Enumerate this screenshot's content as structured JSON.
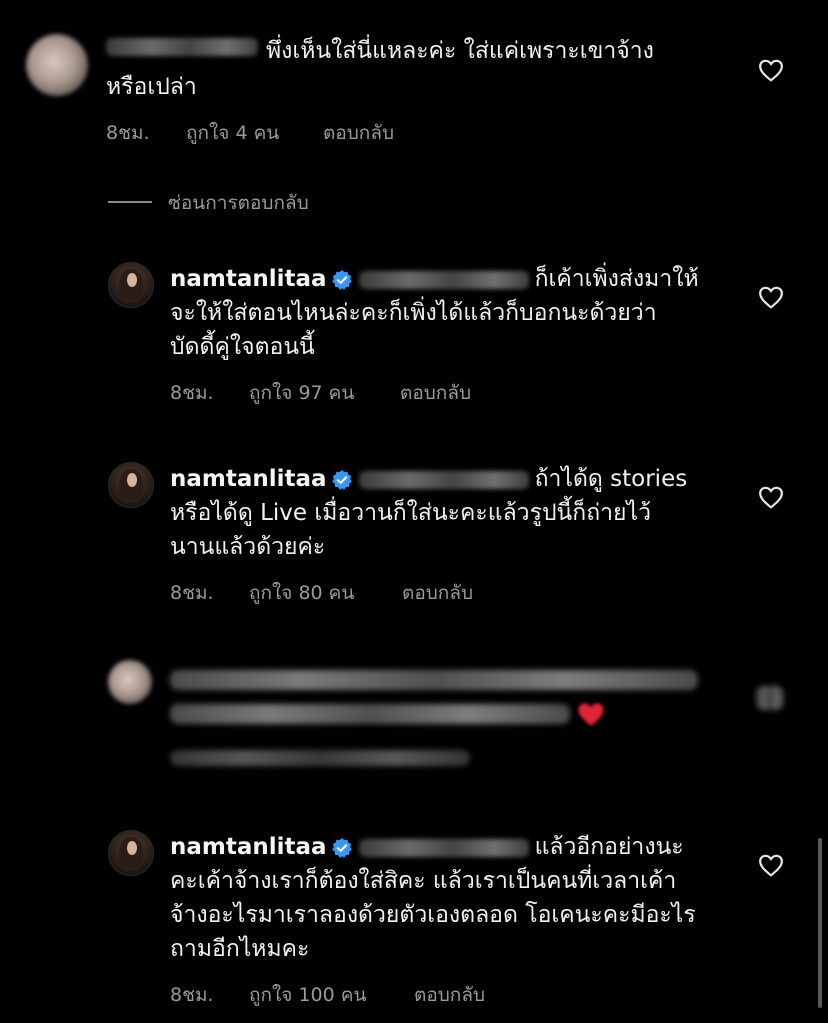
{
  "comment1": {
    "text_line1": "พึ่งเห็นใส่นี่แหละค่ะ ใส่แค่เพราะเขาจ้าง",
    "text_line2": "หรือเปล่า",
    "time": "8ชม.",
    "likes": "ถูกใจ 4 คน",
    "reply": "ตอบกลับ"
  },
  "hide_replies": "ซ่อนการตอบกลับ",
  "replies": [
    {
      "username": "namtanlitaa",
      "line1": "ก็เค้าเพิ่งส่งมาให้",
      "line2": "จะให้ใส่ตอนไหนล่ะคะก็เพิ่งได้แล้วก็บอกนะด้วยว่า",
      "line3": "บัดดี้คู่ใจตอนนี้",
      "time": "8ชม.",
      "likes": "ถูกใจ 97 คน",
      "reply": "ตอบกลับ"
    },
    {
      "username": "namtanlitaa",
      "line1": "ถ้าได้ดู stories",
      "line2": "หรือได้ดู Live เมื่อวานก็ใส่นะคะแล้วรูปนี้ก็ถ่ายไว้",
      "line3": "นานแล้วด้วยค่ะ",
      "time": "8ชม.",
      "likes": "ถูกใจ 80 คน",
      "reply": "ตอบกลับ"
    },
    {
      "username": "namtanlitaa",
      "line1": "แล้วอีกอย่างนะ",
      "line2": "คะเค้าจ้างเราก็ต้องใส่สิคะ แล้วเราเป็นคนที่เวลาเค้า",
      "line3": "จ้างอะไรมาเราลองด้วยตัวเองตลอด โอเคนะคะมีอะไร",
      "line4": "ถามอีกไหมคะ",
      "time": "8ชม.",
      "likes": "ถูกใจ 100 คน",
      "reply": "ตอบกลับ"
    }
  ],
  "colors": {
    "background": "#000000",
    "text": "#f2f2f2",
    "muted": "#9a9a9a",
    "verified": "#3897f0",
    "heart_emoji": "#e0243a"
  },
  "icons": {
    "like": "heart-outline-icon",
    "verified": "verified-badge-icon"
  }
}
